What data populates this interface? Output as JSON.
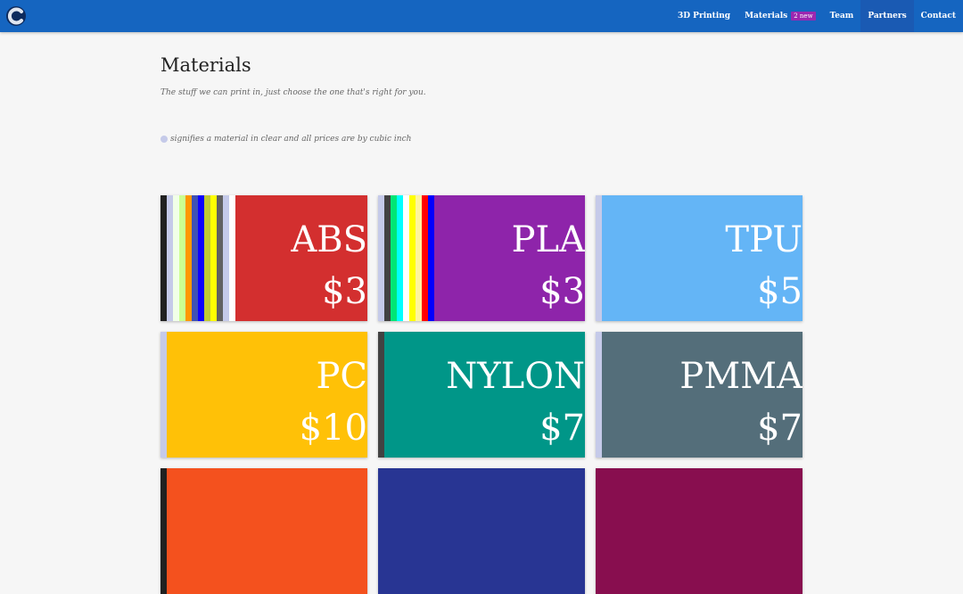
{
  "nav": {
    "items": [
      {
        "label": "3D Printing",
        "badge": "",
        "active": false
      },
      {
        "label": "Materials",
        "badge": "2 new",
        "active": false
      },
      {
        "label": "Team",
        "badge": "",
        "active": false
      },
      {
        "label": "Partners",
        "badge": "",
        "active": true
      },
      {
        "label": "Contact",
        "badge": "",
        "active": false
      }
    ]
  },
  "page": {
    "title": "Materials",
    "subtitle": "The stuff we can print in, just choose the one that's right for you.",
    "legend": "signifies a material in clear and all prices are by cubic inch"
  },
  "colors": {
    "navbar": "#1565c0",
    "badge": "#9c27b0",
    "clear_indicator": "#c5cae9"
  },
  "materials": [
    {
      "name": "ABS",
      "price": "$3",
      "color": "#d32f2f",
      "strips": [
        "#212121",
        "#c5cae9",
        "#f1ffe8",
        "#ccff90",
        "#ff9800",
        "#3f51b5",
        "#0d00ff",
        "#c0ca33",
        "#ffff00",
        "#616161",
        "#c5cae9",
        "#ffffff"
      ]
    },
    {
      "name": "PLA",
      "price": "$3",
      "color": "#8e24aa",
      "strips": [
        "#c5cae9",
        "#424242",
        "#00e676",
        "#00ffff",
        "#ffffff",
        "#ffff00",
        "#fff59d",
        "#ff0000",
        "#0000ff"
      ]
    },
    {
      "name": "TPU",
      "price": "$5",
      "color": "#64b5f6",
      "strips": [
        "#c5cae9"
      ]
    },
    {
      "name": "PC",
      "price": "$10",
      "color": "#ffc107",
      "strips": [
        "#c5cae9"
      ]
    },
    {
      "name": "NYLON",
      "price": "$7",
      "color": "#009688",
      "strips": [
        "#424242"
      ]
    },
    {
      "name": "PMMA",
      "price": "$7",
      "color": "#546e7a",
      "strips": [
        "#c5cae9"
      ]
    },
    {
      "name": "",
      "price": "",
      "color": "#f4511e",
      "strips": [
        "#212121"
      ]
    },
    {
      "name": "",
      "price": "",
      "color": "#283593",
      "strips": []
    },
    {
      "name": "",
      "price": "",
      "color": "#880e4f",
      "strips": []
    }
  ]
}
